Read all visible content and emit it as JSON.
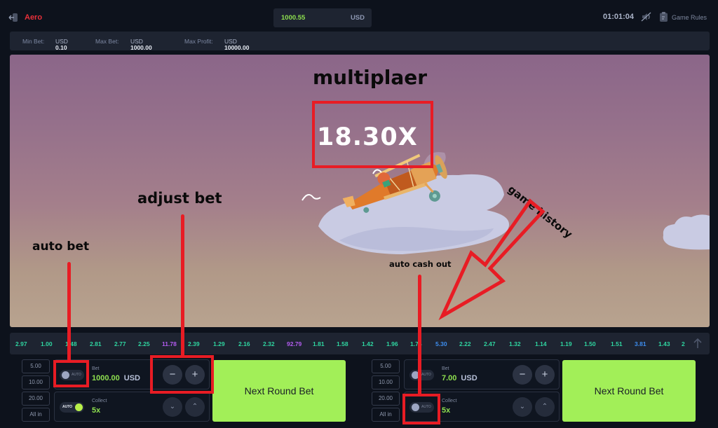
{
  "app": {
    "title": "Aero"
  },
  "header": {
    "balance": "1000.55",
    "currency": "USD",
    "clock": "01:01:04",
    "game_rules_label": "Game Rules",
    "icons": [
      "back-arrow-icon",
      "sound-muted-icon",
      "rules-clipboard-icon"
    ]
  },
  "limits": {
    "min_label": "Min Bet:",
    "min_value": "0.10",
    "min_cur": "USD",
    "max_label": "Max Bet:",
    "max_value": "1000.00",
    "max_cur": "USD",
    "profit_label": "Max Profit:",
    "profit_value": "10000.00",
    "profit_cur": "USD"
  },
  "game": {
    "multiplier": "18.30X",
    "annotations": {
      "multiplier": "multiplaer",
      "adjust_bet": "adjust bet",
      "auto_bet": "auto bet",
      "auto_cash_out": "auto cash out",
      "game_history": "game history"
    }
  },
  "history": {
    "colors": {
      "low": "#2fd6a1",
      "mid": "#3d8ef0",
      "high": "#b35cf0"
    },
    "items": [
      {
        "v": "2.97",
        "c": "low"
      },
      {
        "v": "1.00",
        "c": "low"
      },
      {
        "v": "1.48",
        "c": "low"
      },
      {
        "v": "2.81",
        "c": "low"
      },
      {
        "v": "2.77",
        "c": "low"
      },
      {
        "v": "2.25",
        "c": "low"
      },
      {
        "v": "11.78",
        "c": "high"
      },
      {
        "v": "2.39",
        "c": "low"
      },
      {
        "v": "1.29",
        "c": "low"
      },
      {
        "v": "2.16",
        "c": "low"
      },
      {
        "v": "2.32",
        "c": "low"
      },
      {
        "v": "92.79",
        "c": "high"
      },
      {
        "v": "1.81",
        "c": "low"
      },
      {
        "v": "1.58",
        "c": "low"
      },
      {
        "v": "1.42",
        "c": "low"
      },
      {
        "v": "1.96",
        "c": "low"
      },
      {
        "v": "1.75",
        "c": "low"
      },
      {
        "v": "5.30",
        "c": "mid"
      },
      {
        "v": "2.22",
        "c": "low"
      },
      {
        "v": "2.47",
        "c": "low"
      },
      {
        "v": "1.32",
        "c": "low"
      },
      {
        "v": "1.14",
        "c": "low"
      },
      {
        "v": "1.19",
        "c": "low"
      },
      {
        "v": "1.50",
        "c": "low"
      },
      {
        "v": "1.51",
        "c": "low"
      },
      {
        "v": "3.81",
        "c": "mid"
      },
      {
        "v": "1.43",
        "c": "low"
      },
      {
        "v": "2",
        "c": "low"
      }
    ]
  },
  "bets": [
    {
      "quick": [
        "5.00",
        "10.00",
        "20.00",
        "All in"
      ],
      "auto_label": "AUTO",
      "bet_label": "Bet",
      "bet_value": "1000.00",
      "bet_cur": "USD",
      "collect_label": "Collect",
      "collect_value": "5x",
      "auto_bet_on": false,
      "auto_collect_on": true,
      "minus": "−",
      "plus": "+",
      "down": "⌄",
      "up": "⌃",
      "cta": "Next Round Bet"
    },
    {
      "quick": [
        "5.00",
        "10.00",
        "20.00",
        "All in"
      ],
      "auto_label": "AUTO",
      "bet_label": "Bet",
      "bet_value": "7.00",
      "bet_cur": "USD",
      "collect_label": "Collect",
      "collect_value": "5x",
      "auto_bet_on": false,
      "auto_collect_on": false,
      "minus": "−",
      "plus": "+",
      "down": "⌄",
      "up": "⌃",
      "cta": "Next Round Bet"
    }
  ],
  "colors": {
    "accent": "#a2ef58",
    "brand": "#e8303a",
    "annotation": "#e81c24"
  }
}
